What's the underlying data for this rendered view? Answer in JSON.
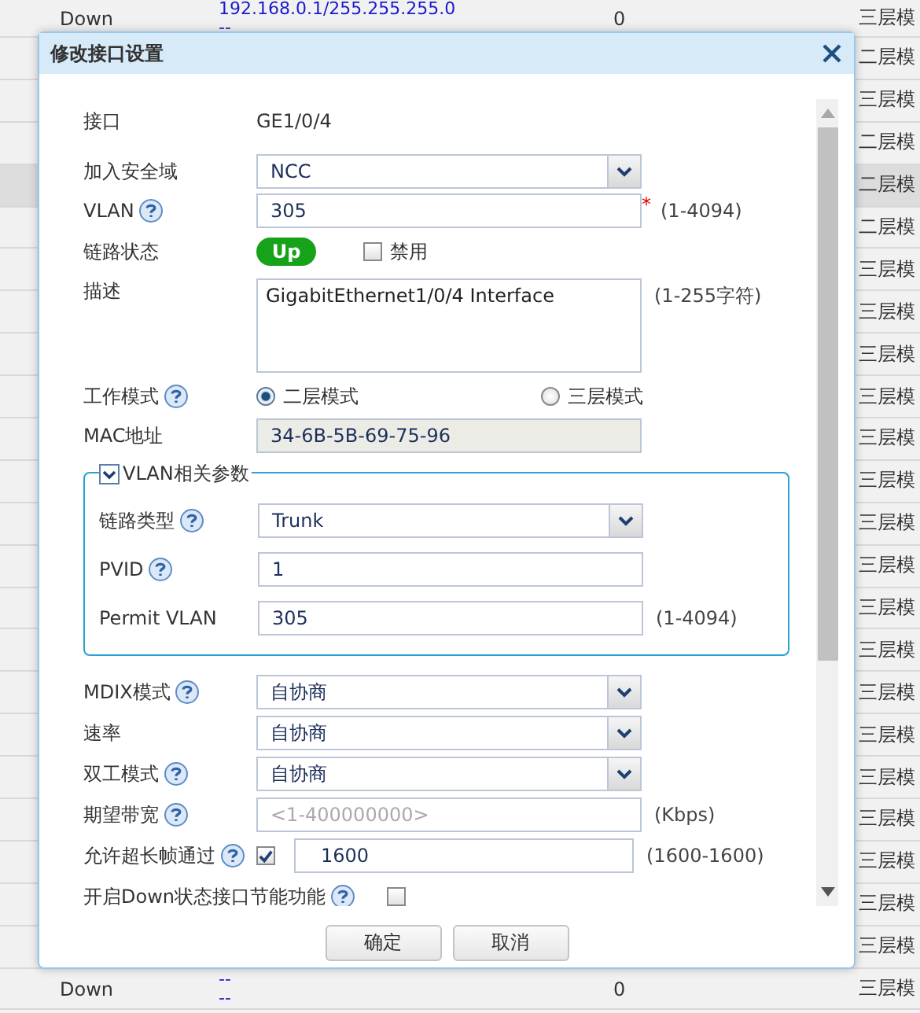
{
  "table": {
    "rows": [
      {
        "selected": false,
        "status": "Down",
        "address": "192.168.0.1/255.255.255.0",
        "address_2": "--",
        "count": "0",
        "mode": "三层模"
      },
      {
        "selected": false,
        "mode": "二层模"
      },
      {
        "selected": false,
        "mode": "三层模"
      },
      {
        "selected": false,
        "mode": "二层模"
      },
      {
        "selected": true,
        "mode": "二层模"
      },
      {
        "selected": false,
        "mode": "二层模"
      },
      {
        "selected": false,
        "mode": "三层模"
      },
      {
        "selected": false,
        "mode": "三层模"
      },
      {
        "selected": false,
        "mode": "三层模"
      },
      {
        "selected": false,
        "mode": "三层模"
      },
      {
        "selected": false,
        "mode": "三层模"
      },
      {
        "selected": false,
        "mode": "三层模"
      },
      {
        "selected": false,
        "mode": "三层模"
      },
      {
        "selected": false,
        "mode": "三层模"
      },
      {
        "selected": false,
        "mode": "三层模"
      },
      {
        "selected": false,
        "mode": "三层模"
      },
      {
        "selected": false,
        "mode": "三层模"
      },
      {
        "selected": false,
        "mode": "三层模"
      },
      {
        "selected": false,
        "mode": "三层模"
      },
      {
        "selected": false,
        "mode": "三层模"
      },
      {
        "selected": false,
        "mode": "三层模"
      },
      {
        "selected": false,
        "mode": "三层模"
      },
      {
        "selected": false,
        "mode": "三层模"
      },
      {
        "selected": false,
        "status": "Down",
        "address": "--",
        "address_2": "--",
        "count": "0",
        "mode": "三层模"
      }
    ]
  },
  "dialog": {
    "title": "修改接口设置",
    "fields": [
      {
        "kind": "static",
        "label": "接口",
        "help": false,
        "value": "GE1/0/4"
      },
      {
        "kind": "select",
        "label": "加入安全域",
        "help": false,
        "value": "NCC"
      },
      {
        "kind": "input",
        "label": "VLAN",
        "help": true,
        "value": "305",
        "required_mark": "*",
        "hint": "(1-4094)"
      },
      {
        "kind": "status",
        "label": "链路状态",
        "help": false,
        "status": "Up",
        "option": {
          "label": "禁用",
          "checked": false
        }
      },
      {
        "kind": "textarea",
        "label": "描述",
        "help": false,
        "value": "GigabitEthernet1/0/4 Interface",
        "hint": "(1-255字符)"
      },
      {
        "kind": "radio",
        "label": "工作模式",
        "help": true,
        "options": [
          {
            "label": "二层模式",
            "selected": true
          },
          {
            "label": "三层模式",
            "selected": false
          }
        ]
      },
      {
        "kind": "readonly",
        "label": "MAC地址",
        "help": false,
        "value": "34-6B-5B-69-75-96"
      }
    ],
    "group": {
      "title": "VLAN相关参数",
      "expanded": true,
      "fields": [
        {
          "kind": "select",
          "label": "链路类型",
          "help": true,
          "value": "Trunk"
        },
        {
          "kind": "input",
          "label": "PVID",
          "help": true,
          "value": "1"
        },
        {
          "kind": "input",
          "label": "Permit VLAN",
          "help": false,
          "value": "305",
          "hint": "(1-4094)"
        }
      ]
    },
    "fields_2": [
      {
        "kind": "select",
        "label": "MDIX模式",
        "help": true,
        "value": "自协商"
      },
      {
        "kind": "select",
        "label": "速率",
        "help": false,
        "value": "自协商"
      },
      {
        "kind": "select",
        "label": "双工模式",
        "help": true,
        "value": "自协商"
      },
      {
        "kind": "input",
        "label": "期望带宽",
        "help": true,
        "placeholder": "<1-400000000>",
        "hint": "(Kbps)"
      },
      {
        "kind": "check-input",
        "label": "允许超长帧通过",
        "help": true,
        "checked": true,
        "value": "1600",
        "hint": "(1600-1600)"
      },
      {
        "kind": "checkbox",
        "label": "开启Down状态接口节能功能",
        "help": true,
        "checked": false
      }
    ],
    "buttons": [
      "确定",
      "取消"
    ]
  }
}
